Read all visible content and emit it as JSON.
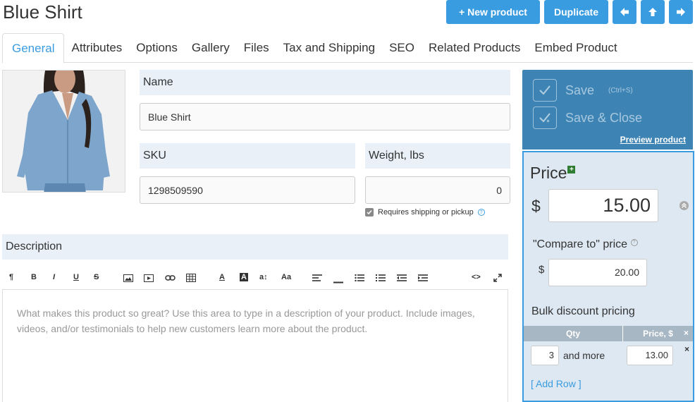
{
  "page": {
    "title": "Blue Shirt"
  },
  "header_buttons": {
    "new_product": "+ New product",
    "duplicate": "Duplicate",
    "prev_icon": "arrow-left-icon",
    "up_icon": "arrow-up-icon",
    "next_icon": "arrow-right-icon"
  },
  "tabs": [
    {
      "label": "General",
      "active": true
    },
    {
      "label": "Attributes"
    },
    {
      "label": "Options"
    },
    {
      "label": "Gallery"
    },
    {
      "label": "Files"
    },
    {
      "label": "Tax and Shipping"
    },
    {
      "label": "SEO"
    },
    {
      "label": "Related Products"
    },
    {
      "label": "Embed Product"
    }
  ],
  "general": {
    "name_label": "Name",
    "name_value": "Blue Shirt",
    "sku_label": "SKU",
    "sku_value": "1298509590",
    "weight_label": "Weight, lbs",
    "weight_value": "0",
    "requires_shipping": "Requires shipping or pickup",
    "description_label": "Description",
    "description_placeholder": "What makes this product so great? Use this area to type in a description of your product. Include images, videos, and/or testimonials to help new customers learn more about the product."
  },
  "editor_toolbar": [
    "paragraph-icon",
    "bold-icon",
    "italic-icon",
    "underline-icon",
    "strikethrough-icon",
    "image-icon",
    "video-icon",
    "link-icon",
    "table-icon",
    "font-color-icon",
    "highlight-icon",
    "font-size-icon",
    "font-family-icon",
    "align-icon",
    "horizontal-rule-icon",
    "bullet-list-icon",
    "numbered-list-icon",
    "outdent-icon",
    "indent-icon",
    "code-view-icon",
    "fullscreen-icon"
  ],
  "toolbar_glyphs": {
    "paragraph": "¶",
    "bold": "B",
    "italic": "I",
    "underline": "U",
    "strike": "S",
    "font_color": "A",
    "highlight": "A",
    "font_size": "a↕",
    "font_family": "Aa",
    "code": "<>"
  },
  "save_panel": {
    "save": "Save",
    "shortcut": "(Ctrl+S)",
    "save_close": "Save & Close",
    "preview": "Preview product"
  },
  "pricing": {
    "title": "Price",
    "currency": "$",
    "price": "15.00",
    "compare_label": "\"Compare to\" price",
    "compare_price": "20.00",
    "bulk_label": "Bulk discount pricing",
    "col_qty": "Qty",
    "col_price": "Price, $",
    "remove": "×",
    "rows": [
      {
        "qty": "3",
        "and_more": "and more",
        "price": "13.00"
      }
    ],
    "add_row": "[ Add Row ]"
  },
  "colors": {
    "accent": "#3a9ce0",
    "save_panel": "#3d84b5",
    "price_panel": "#dde8f2",
    "label_band": "#e9f0f8"
  }
}
